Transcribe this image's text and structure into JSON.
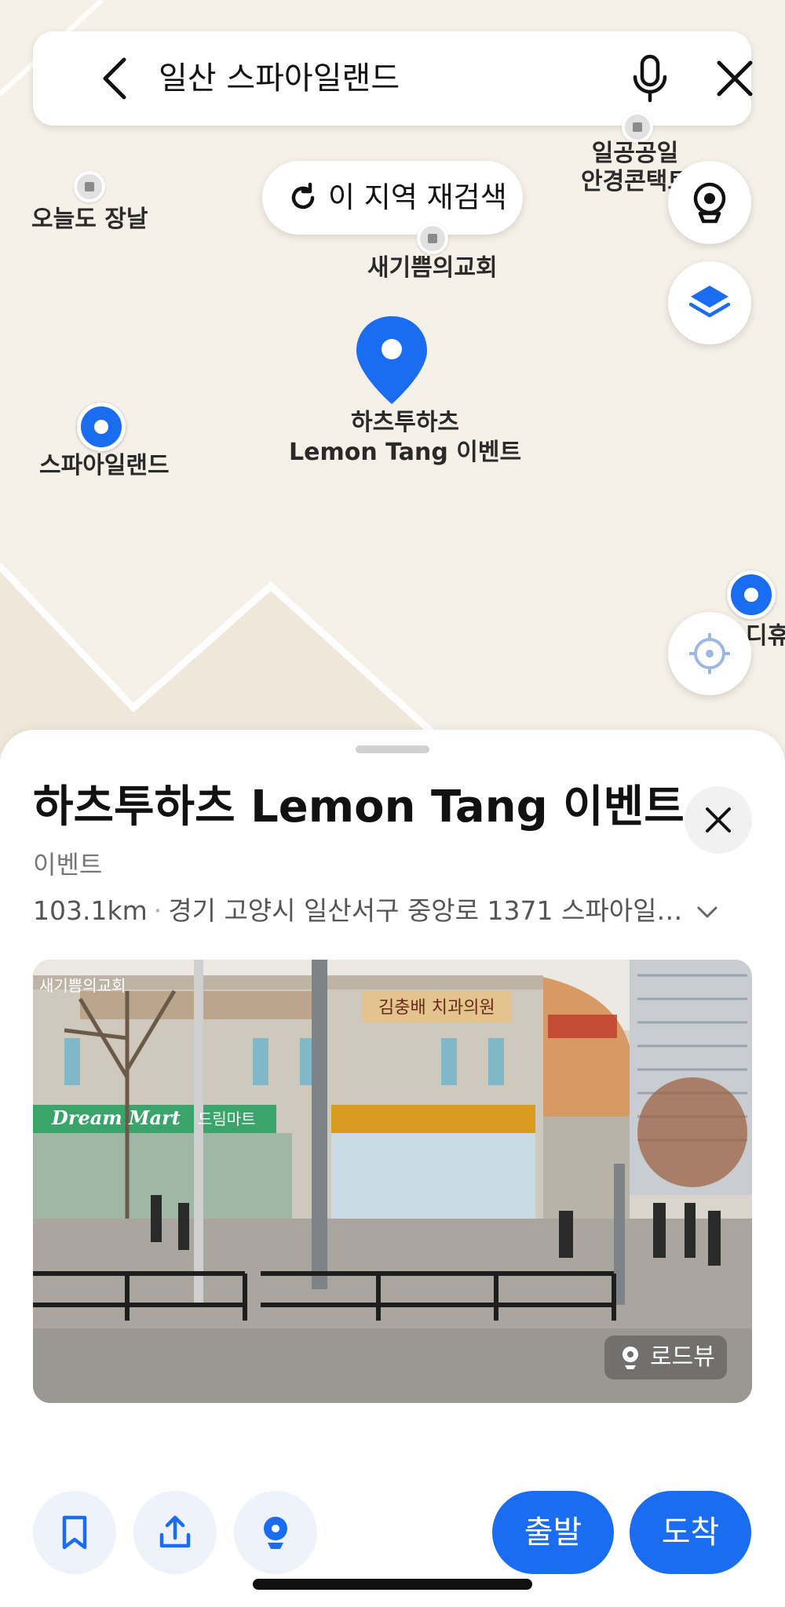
{
  "search": {
    "query": "일산 스파아일랜드"
  },
  "map": {
    "research_button": "이 지역 재검색",
    "pois": [
      {
        "name": "오늘도 장날"
      },
      {
        "name": "새기쁨의교회"
      },
      {
        "name": "일공공일\n안경콘택트"
      },
      {
        "name": "스파아일랜드"
      },
      {
        "name": "디휴"
      }
    ],
    "selected_pin_label": "하츠투하츠\nLemon Tang 이벤트"
  },
  "place": {
    "title": "하츠투하츠 Lemon Tang 이벤트",
    "category": "이벤트",
    "distance": "103.1km",
    "address": "경기 고양시 일산서구 중앙로 1371 스파아일…",
    "photo_badge": "로드뷰",
    "sign_texts": [
      "새기쁨의교회",
      "김충배 치과의원",
      "Dream Mart",
      "드림마트"
    ]
  },
  "actions": {
    "depart": "출발",
    "arrive": "도착"
  },
  "colors": {
    "accent": "#1a6cf0",
    "map_bg": "#f5f1e9"
  }
}
